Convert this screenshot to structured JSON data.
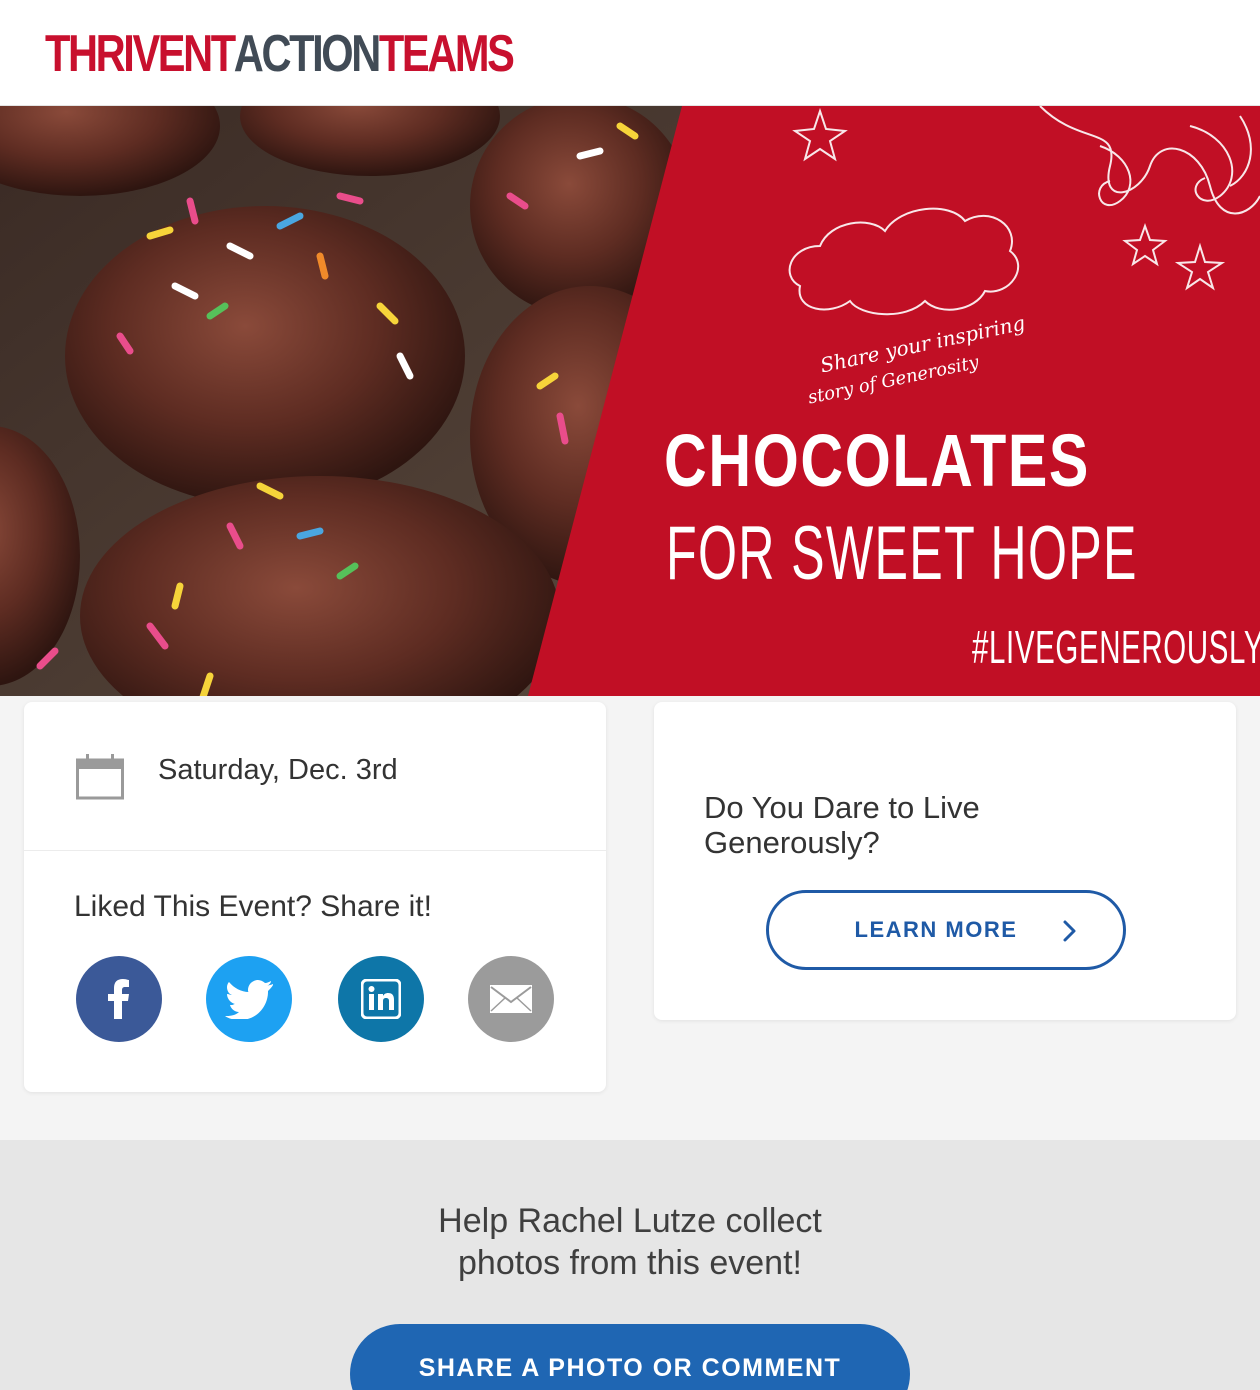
{
  "header": {
    "logo_part1": "THRIVENT",
    "logo_part2": "ACTION",
    "logo_part3": "TEAMS"
  },
  "hero": {
    "cloud_line1": "Share your inspiring",
    "cloud_line2": "story of Generosity",
    "title_line1": "CHOCOLATES",
    "title_line2": "FOR SWEET HOPE",
    "hashtag": "#LIVEGENEROUSLY"
  },
  "event_card": {
    "date": "Saturday, Dec. 3rd",
    "share_heading": "Liked This Event? Share it!",
    "social_icons": [
      "facebook-icon",
      "twitter-icon",
      "linkedin-icon",
      "email-icon"
    ]
  },
  "promo_card": {
    "title": "Do You Dare to Live Generously?",
    "button_label": "LEARN MORE"
  },
  "bottom": {
    "help_line1": "Help Rachel Lutze collect",
    "help_line2": "photos from this event!",
    "button_label": "SHARE A PHOTO OR COMMENT"
  },
  "colors": {
    "brand_red": "#c8102e",
    "brand_gray": "#414b56",
    "hero_red": "#c10f25",
    "button_blue": "#1f66b3",
    "outline_blue": "#1f5aa6",
    "facebook": "#3b5998",
    "twitter": "#1da1f2",
    "linkedin": "#0e76a8",
    "email": "#9b9b9b"
  }
}
